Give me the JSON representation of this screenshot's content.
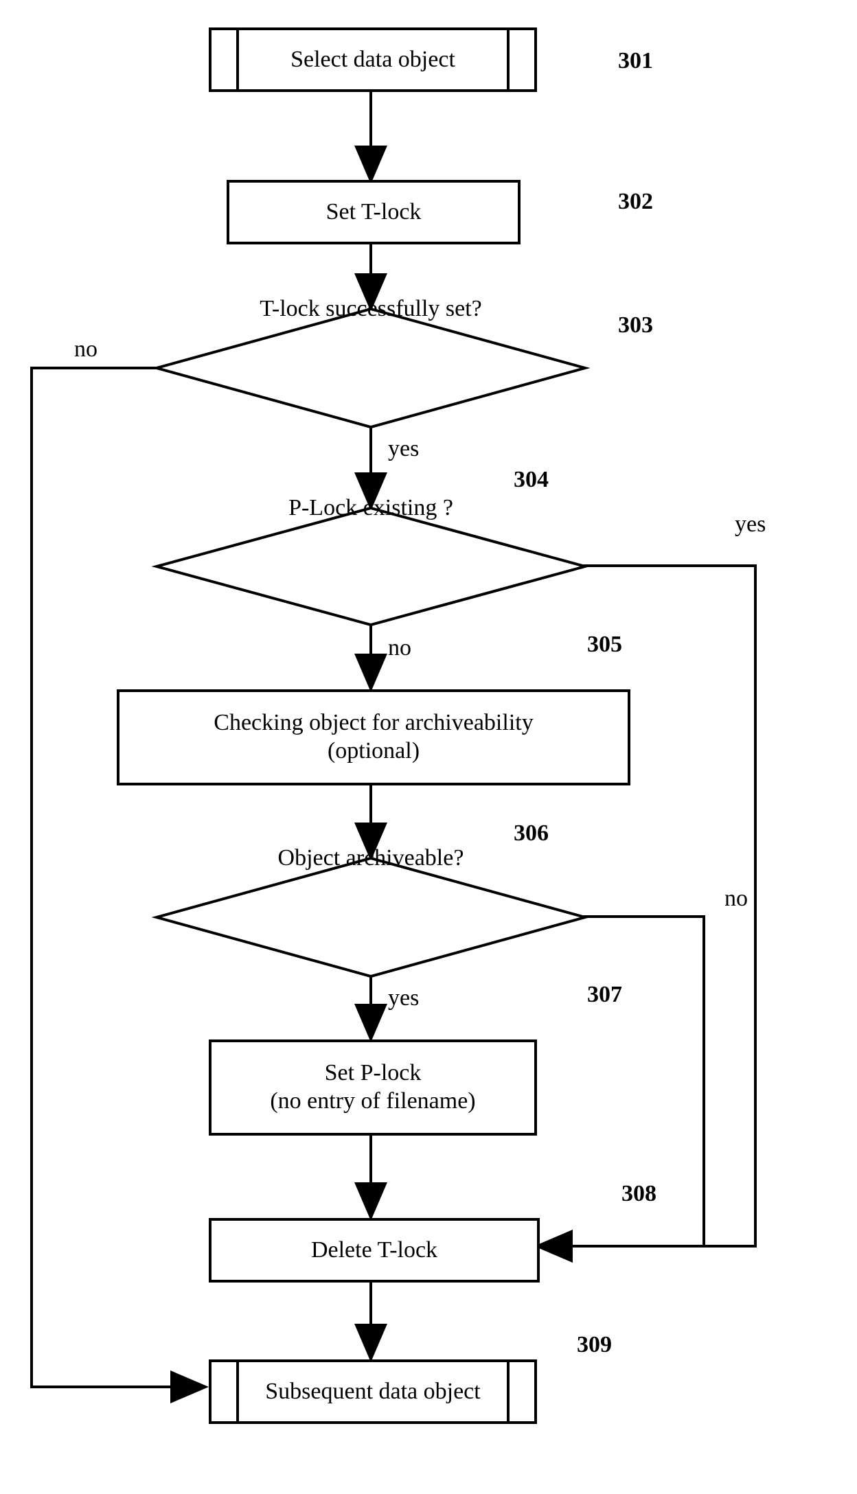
{
  "chart_data": {
    "type": "flowchart",
    "nodes": [
      {
        "id": "301",
        "shape": "terminal",
        "text": "Select data object"
      },
      {
        "id": "302",
        "shape": "process",
        "text": "Set T-lock"
      },
      {
        "id": "303",
        "shape": "decision",
        "text": "T-lock successfully set?"
      },
      {
        "id": "304",
        "shape": "decision",
        "text": "P-Lock existing ?"
      },
      {
        "id": "305",
        "shape": "process",
        "text": "Checking object for archiveability\n(optional)"
      },
      {
        "id": "306",
        "shape": "decision",
        "text": "Object archiveable?"
      },
      {
        "id": "307",
        "shape": "process",
        "text": "Set P-lock\n(no entry of filename)"
      },
      {
        "id": "308",
        "shape": "process",
        "text": "Delete T-lock"
      },
      {
        "id": "309",
        "shape": "terminal",
        "text": "Subsequent data object"
      }
    ],
    "edges": [
      {
        "from": "301",
        "to": "302"
      },
      {
        "from": "302",
        "to": "303"
      },
      {
        "from": "303",
        "to": "304",
        "label": "yes"
      },
      {
        "from": "303",
        "to": "309",
        "label": "no"
      },
      {
        "from": "304",
        "to": "305",
        "label": "no"
      },
      {
        "from": "304",
        "to": "308",
        "label": "yes"
      },
      {
        "from": "305",
        "to": "306"
      },
      {
        "from": "306",
        "to": "307",
        "label": "yes"
      },
      {
        "from": "306",
        "to": "308",
        "label": "no"
      },
      {
        "from": "307",
        "to": "308"
      },
      {
        "from": "308",
        "to": "309"
      }
    ]
  },
  "nodes": {
    "n301": "Select data object",
    "n302": "Set T-lock",
    "n303": "T-lock successfully set?",
    "n304": "P-Lock existing ?",
    "n305_a": "Checking object for archiveability",
    "n305_b": "(optional)",
    "n306": "Object archiveable?",
    "n307_a": "Set P-lock",
    "n307_b": "(no entry of filename)",
    "n308": "Delete T-lock",
    "n309": "Subsequent data object"
  },
  "labels": {
    "l301": "301",
    "l302": "302",
    "l303": "303",
    "l304": "304",
    "l305": "305",
    "l306": "306",
    "l307": "307",
    "l308": "308",
    "l309": "309"
  },
  "answers": {
    "yes": "yes",
    "no": "no"
  }
}
